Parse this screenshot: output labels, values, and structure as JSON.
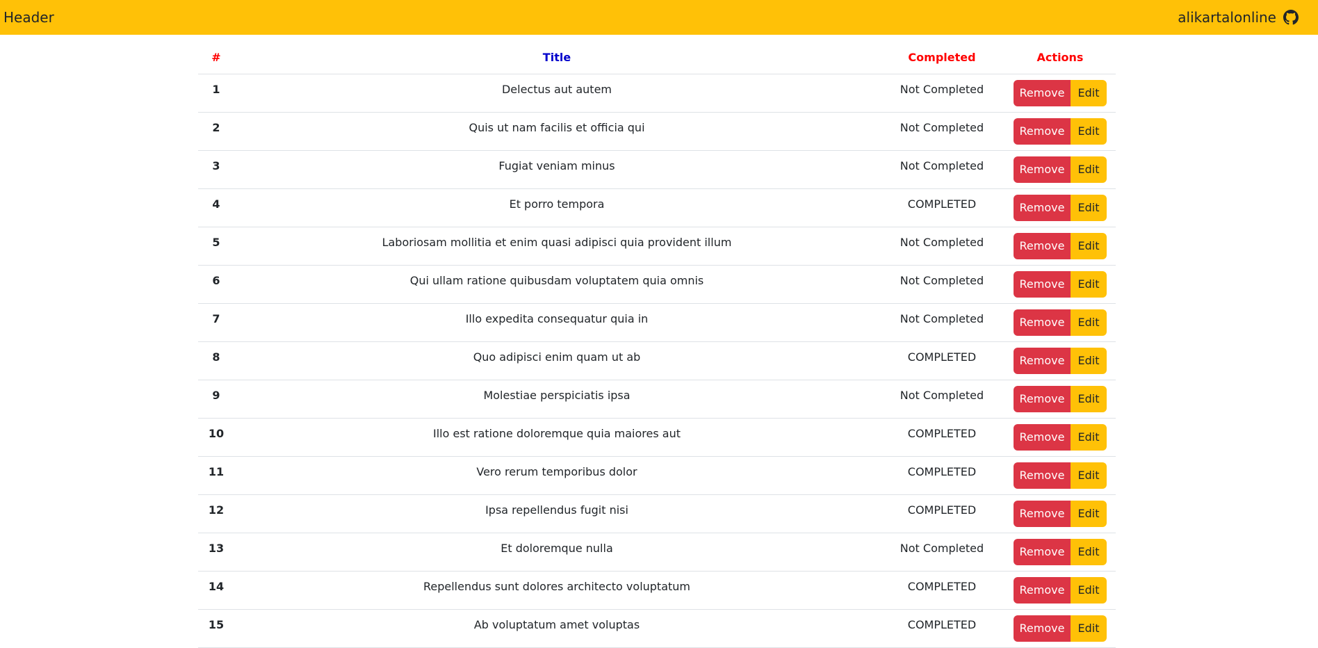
{
  "header": {
    "brand": "Header",
    "username": "alikartalonline",
    "github_icon": "github-icon",
    "background": "#ffc107"
  },
  "table": {
    "columns": {
      "num": "#",
      "title": "Title",
      "completed": "Completed",
      "actions": "Actions"
    },
    "header_colors": {
      "num": "#ff0000",
      "title": "#0000cc",
      "completed": "#ff0000",
      "actions": "#ff0000"
    },
    "remove_label": "Remove",
    "edit_label": "Edit",
    "rows": [
      {
        "id": "1",
        "title": "Delectus aut autem",
        "status": "Not Completed"
      },
      {
        "id": "2",
        "title": "Quis ut nam facilis et officia qui",
        "status": "Not Completed"
      },
      {
        "id": "3",
        "title": "Fugiat veniam minus",
        "status": "Not Completed"
      },
      {
        "id": "4",
        "title": "Et porro tempora",
        "status": "COMPLETED"
      },
      {
        "id": "5",
        "title": "Laboriosam mollitia et enim quasi adipisci quia provident illum",
        "status": "Not Completed"
      },
      {
        "id": "6",
        "title": "Qui ullam ratione quibusdam voluptatem quia omnis",
        "status": "Not Completed"
      },
      {
        "id": "7",
        "title": "Illo expedita consequatur quia in",
        "status": "Not Completed"
      },
      {
        "id": "8",
        "title": "Quo adipisci enim quam ut ab",
        "status": "COMPLETED"
      },
      {
        "id": "9",
        "title": "Molestiae perspiciatis ipsa",
        "status": "Not Completed"
      },
      {
        "id": "10",
        "title": "Illo est ratione doloremque quia maiores aut",
        "status": "COMPLETED"
      },
      {
        "id": "11",
        "title": "Vero rerum temporibus dolor",
        "status": "COMPLETED"
      },
      {
        "id": "12",
        "title": "Ipsa repellendus fugit nisi",
        "status": "COMPLETED"
      },
      {
        "id": "13",
        "title": "Et doloremque nulla",
        "status": "Not Completed"
      },
      {
        "id": "14",
        "title": "Repellendus sunt dolores architecto voluptatum",
        "status": "COMPLETED"
      },
      {
        "id": "15",
        "title": "Ab voluptatum amet voluptas",
        "status": "COMPLETED"
      }
    ]
  },
  "colors": {
    "remove_button": "#dc3545",
    "edit_button": "#ffc107"
  }
}
